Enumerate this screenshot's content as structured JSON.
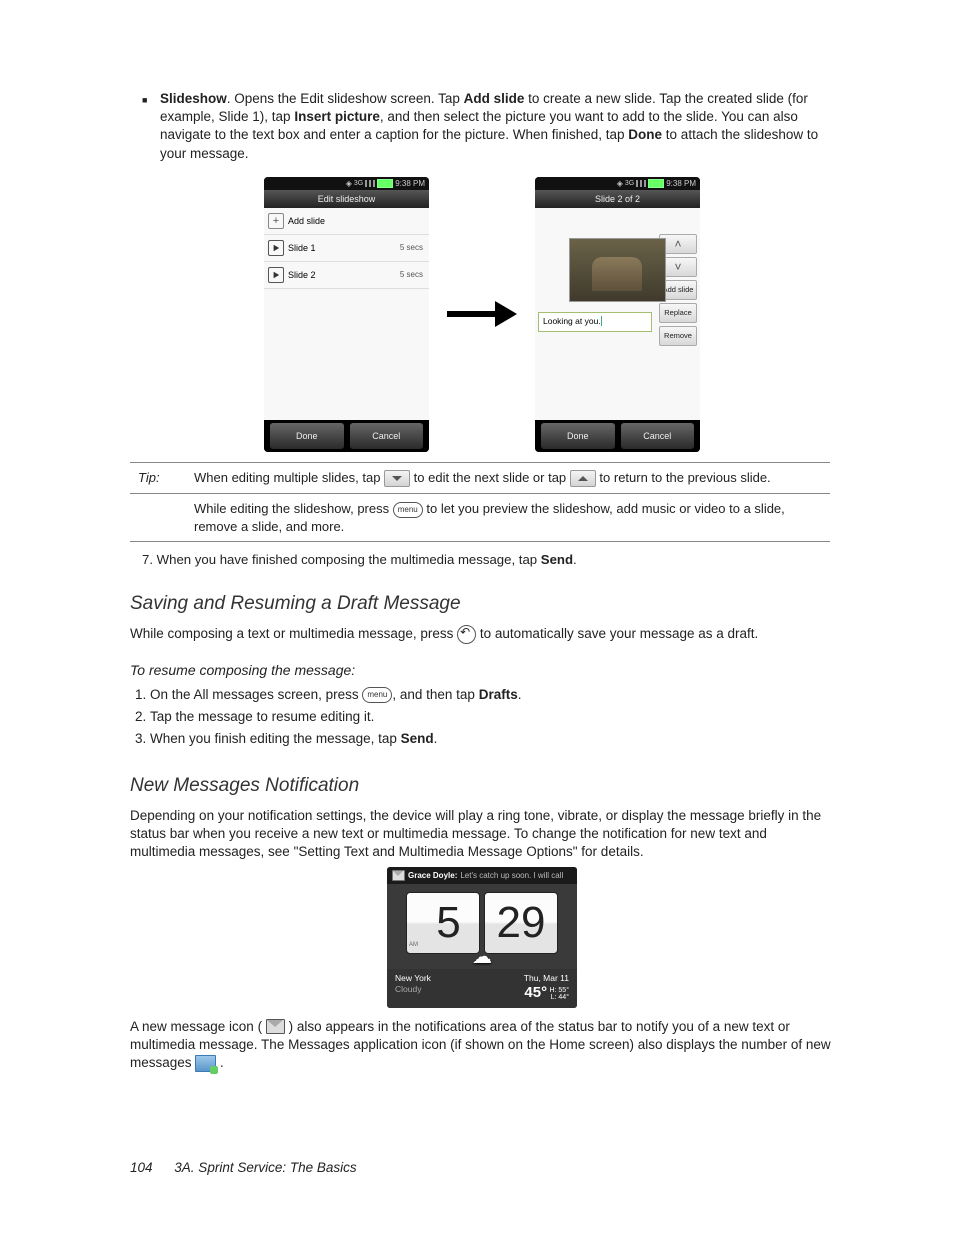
{
  "bullet": {
    "title": "Slideshow",
    "t1": ". Opens the Edit slideshow screen. Tap ",
    "add_slide": "Add slide",
    "t2": " to create a new slide. Tap the created slide (for example, Slide 1), tap ",
    "insert_picture": "Insert picture",
    "t3": ", and then select the picture you want to add to the slide. You can also navigate to the text box and enter a caption for the picture. When finished, tap ",
    "done": "Done",
    "t4": " to attach the slideshow to your message."
  },
  "phone_a": {
    "time": "9:38 PM",
    "title": "Edit slideshow",
    "row_add": "Add slide",
    "rows": [
      {
        "label": "Slide 1",
        "dur": "5 secs"
      },
      {
        "label": "Slide 2",
        "dur": "5 secs"
      }
    ],
    "done": "Done",
    "cancel": "Cancel"
  },
  "phone_b": {
    "time": "9:38 PM",
    "title": "Slide 2 of 2",
    "btn_up": "˄",
    "btn_down": "˅",
    "btn_add": "Add slide",
    "btn_replace": "Replace",
    "btn_remove": "Remove",
    "caption": "Looking at you.",
    "done": "Done",
    "cancel": "Cancel"
  },
  "tip": {
    "label": "Tip:",
    "row1_a": "When editing multiple slides, tap ",
    "row1_b": " to edit the next slide or tap ",
    "row1_c": " to return to the previous slide.",
    "row2_a": "While editing the slideshow, press ",
    "menu": "menu",
    "row2_b": " to let you preview the slideshow, add music or video to a slide, remove a slide, and more."
  },
  "step7": {
    "a": "7. When you have finished composing the multimedia message, tap ",
    "b": "Send",
    "c": "."
  },
  "sect1": {
    "h": "Saving and Resuming a Draft Message",
    "p_a": "While composing a text or multimedia message, press ",
    "p_b": " to automatically save your message as a draft.",
    "sub": "To resume composing the message:",
    "s1_a": "On the All messages screen, press ",
    "s1_b": ", and then tap ",
    "s1_c": "Drafts",
    "s1_d": ".",
    "s2": "Tap the message to resume editing it.",
    "s3_a": "When you finish editing the message, tap ",
    "s3_b": "Send",
    "s3_c": "."
  },
  "sect2": {
    "h": "New Messages Notification",
    "p": "Depending on your notification settings, the device will play a ring tone, vibrate, or display the message briefly in the status bar when you receive a new text or multimedia message. To change the notification for new text and multimedia messages, see \"Setting Text and Multimedia Message Options\" for details."
  },
  "widget": {
    "name": "Grace Doyle:",
    "msg": "Let's catch up soon. I will call",
    "hour": "5",
    "min": "29",
    "ampm": "AM",
    "city": "New York",
    "cond": "Cloudy",
    "date": "Thu, Mar 11",
    "temp": "45°",
    "hi": "H: 55°",
    "lo": "L: 44°"
  },
  "tail": {
    "a": "A new message icon ( ",
    "b": " ) also appears in the notifications area of the status bar to notify you of a new text or multimedia message. The Messages application icon (if shown on the Home screen) also displays the number of new messages ",
    "c": "."
  },
  "footer": {
    "page": "104",
    "crumb": "3A. Sprint Service: The Basics"
  }
}
